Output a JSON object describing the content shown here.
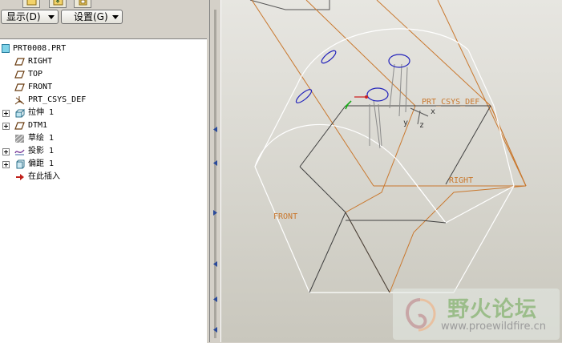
{
  "toolbar": {
    "show_label": "显示(D)",
    "settings_label": "设置(G)"
  },
  "tree": {
    "root": "PRT0008.PRT",
    "items": [
      {
        "label": "RIGHT",
        "icon": "datum-plane-icon",
        "expandable": false
      },
      {
        "label": "TOP",
        "icon": "datum-plane-icon",
        "expandable": false
      },
      {
        "label": "FRONT",
        "icon": "datum-plane-icon",
        "expandable": false
      },
      {
        "label": "PRT_CSYS_DEF",
        "icon": "coordinate-system-icon",
        "expandable": false
      },
      {
        "label": "拉伸 1",
        "icon": "extrude-icon",
        "expandable": true
      },
      {
        "label": "DTM1",
        "icon": "datum-plane-icon",
        "expandable": true
      },
      {
        "label": "草绘 1",
        "icon": "sketch-icon",
        "expandable": false
      },
      {
        "label": "投影 1",
        "icon": "projection-icon",
        "expandable": true
      },
      {
        "label": "偏距 1",
        "icon": "offset-icon",
        "expandable": true
      },
      {
        "label": "在此插入",
        "icon": "insert-here-arrow-icon",
        "expandable": false
      }
    ]
  },
  "viewport": {
    "labels": {
      "csys": "PRT_CSYS_DEF",
      "right": "RIGHT",
      "front": "FRONT",
      "axis_y": "y",
      "axis_z": "z",
      "axis_x": "x"
    },
    "colors": {
      "datum": "#c9782e",
      "edge": "#ffffff",
      "dark_edge": "#404040",
      "curve": "#2222bb"
    }
  },
  "watermark": {
    "title": "野火论坛",
    "url": "www.proewildfire.cn"
  }
}
